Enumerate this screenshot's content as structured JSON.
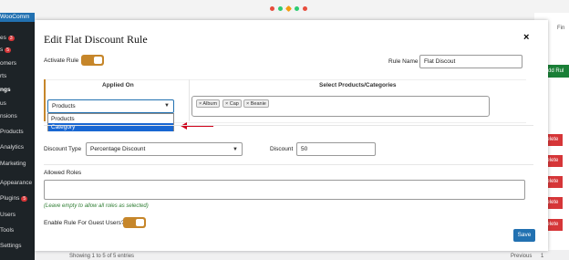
{
  "sidebar": {
    "items": [
      {
        "label": "WooComm",
        "badge": ""
      },
      {
        "label": "es",
        "badge": "3"
      },
      {
        "label": "s",
        "badge": "5"
      },
      {
        "label": "omers",
        "badge": ""
      },
      {
        "label": "rts",
        "badge": ""
      },
      {
        "label": "ngs",
        "badge": ""
      },
      {
        "label": "us",
        "badge": ""
      },
      {
        "label": "nsions",
        "badge": ""
      },
      {
        "label": "Products",
        "badge": ""
      },
      {
        "label": "Analytics",
        "badge": ""
      },
      {
        "label": "Marketing",
        "badge": ""
      },
      {
        "label": "Appearance",
        "badge": ""
      },
      {
        "label": "Plugins",
        "badge": "5"
      },
      {
        "label": "Users",
        "badge": ""
      },
      {
        "label": "Tools",
        "badge": ""
      },
      {
        "label": "Settings",
        "badge": ""
      }
    ]
  },
  "background": {
    "top_right_a": "ty",
    "top_right_b": "Fin",
    "add_rule": "Add Rul",
    "delete_label": "Delete",
    "entries_text": "Showing 1 to 5 of 5 entries",
    "previous": "Previous",
    "page_num": "1"
  },
  "modal": {
    "title": "Edit Flat Discount Rule",
    "close": "×",
    "activate_rule_label": "Activate Rule",
    "rule_name_label": "Rule Name",
    "rule_name_value": "Flat Discout",
    "applied_on_header": "Applied On",
    "select_products_header": "Select Products/Categories",
    "applied_on_value": "Products",
    "applied_on_options": [
      "Products",
      "Category"
    ],
    "tags": [
      "× Album",
      "× Cap",
      "× Beanie"
    ],
    "discount_type_label": "Discount Type",
    "discount_type_value": "Percentage Discount",
    "discount_label": "Discount",
    "discount_value": "50",
    "allowed_roles_label": "Allowed Roles",
    "allowed_roles_hint": "(Leave empty to allow all roles as selected)",
    "guest_label": "Enable Rule For Guest Users?",
    "save_label": "Save"
  },
  "colors": {
    "accent": "#c6862a",
    "primary": "#2271b1",
    "delete": "#d63638",
    "add": "#1a7f37",
    "highlight": "#1967d2",
    "arrow": "#d0021b"
  }
}
